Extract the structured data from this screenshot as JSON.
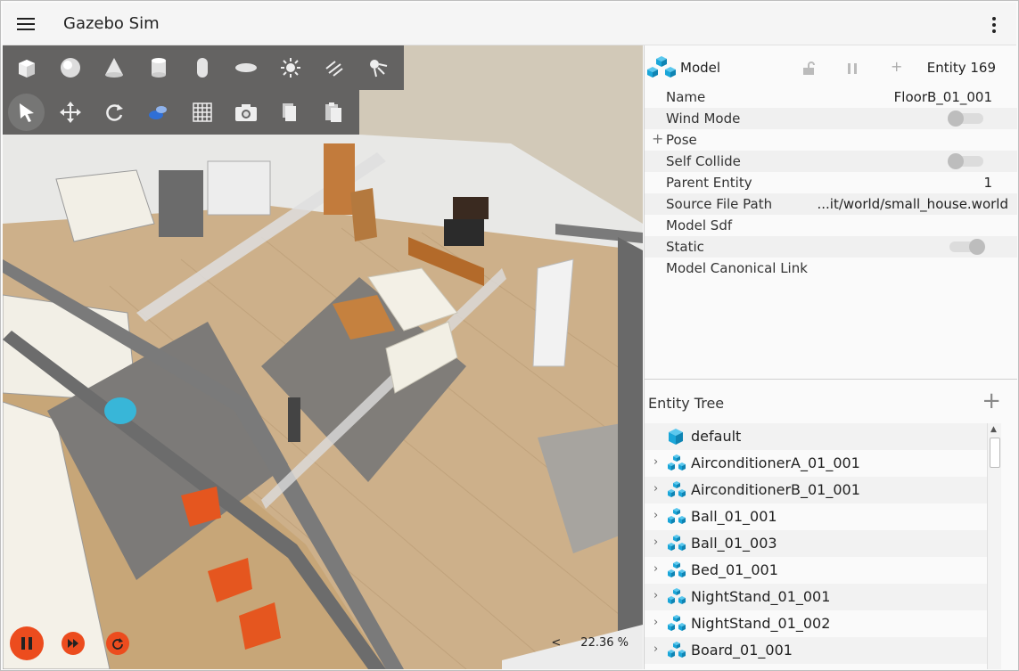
{
  "header": {
    "title": "Gazebo Sim"
  },
  "toolbar": {
    "row1": [
      "box-icon",
      "sphere-icon",
      "cone-icon",
      "cylinder-icon",
      "capsule-icon",
      "ellipsoid-icon",
      "sun-icon",
      "directional-light-icon",
      "spot-light-icon"
    ],
    "row2": [
      "select-icon",
      "translate-icon",
      "rotate-icon",
      "transform-control-icon",
      "grid-icon",
      "screenshot-icon",
      "copy-icon",
      "paste-icon"
    ]
  },
  "component_inspector": {
    "type_label": "Model",
    "entity_label": "Entity 169",
    "properties": [
      {
        "key": "Name",
        "value": "FloorB_01_001"
      },
      {
        "key": "Wind Mode",
        "toggle": "off"
      },
      {
        "key": "Pose",
        "expand": "+"
      },
      {
        "key": "Self Collide",
        "toggle": "off"
      },
      {
        "key": "Parent Entity",
        "value": "1"
      },
      {
        "key": "Source File Path",
        "value": "...it/world/small_house.world"
      },
      {
        "key": "Model Sdf"
      },
      {
        "key": "Static",
        "toggle": "on"
      },
      {
        "key": "Model Canonical Link"
      }
    ]
  },
  "entity_tree": {
    "title": "Entity Tree",
    "add_label": "+",
    "items": [
      {
        "name": "default",
        "expandable": false,
        "icon": "world-icon"
      },
      {
        "name": "AirconditionerA_01_001",
        "expandable": true,
        "icon": "model-icon"
      },
      {
        "name": "AirconditionerB_01_001",
        "expandable": true,
        "icon": "model-icon"
      },
      {
        "name": "Ball_01_001",
        "expandable": true,
        "icon": "model-icon"
      },
      {
        "name": "Ball_01_003",
        "expandable": true,
        "icon": "model-icon"
      },
      {
        "name": "Bed_01_001",
        "expandable": true,
        "icon": "model-icon"
      },
      {
        "name": "NightStand_01_001",
        "expandable": true,
        "icon": "model-icon"
      },
      {
        "name": "NightStand_01_002",
        "expandable": true,
        "icon": "model-icon"
      },
      {
        "name": "Board_01_001",
        "expandable": true,
        "icon": "model-icon"
      }
    ]
  },
  "playback": {
    "real_time_factor": "22.36 %",
    "prev_label": "<"
  },
  "colors": {
    "accent": "#ec4c1e",
    "toolbar": "#5a5a5a",
    "model_icon": "#1aa6d9"
  }
}
